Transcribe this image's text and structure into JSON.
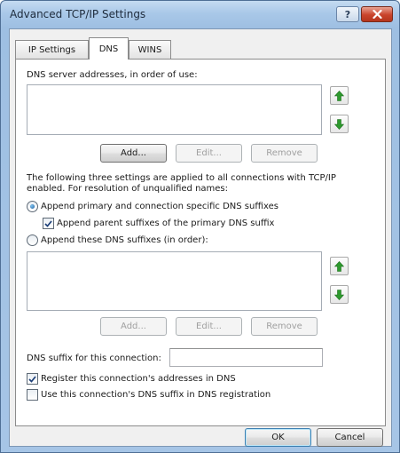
{
  "window": {
    "title": "Advanced TCP/IP Settings",
    "help_glyph": "?"
  },
  "tabs": [
    {
      "label": "IP Settings",
      "selected": false
    },
    {
      "label": "DNS",
      "selected": true
    },
    {
      "label": "WINS",
      "selected": false
    }
  ],
  "dns_servers": {
    "label": "DNS server addresses, in order of use:",
    "items": [],
    "buttons": {
      "add": "Add...",
      "edit": "Edit...",
      "remove": "Remove"
    }
  },
  "resolution": {
    "description_line1": "The following three settings are applied to all connections with TCP/IP",
    "description_line2": "enabled. For resolution of unqualified names:",
    "append_primary_label": "Append primary and connection specific DNS suffixes",
    "append_primary_selected": true,
    "append_parent_label": "Append parent suffixes of the primary DNS suffix",
    "append_parent_checked": true,
    "append_these_label": "Append these DNS suffixes (in order):",
    "append_these_selected": false
  },
  "dns_suffixes": {
    "items": [],
    "buttons": {
      "add": "Add...",
      "edit": "Edit...",
      "remove": "Remove"
    }
  },
  "connection_suffix": {
    "label": "DNS suffix for this connection:",
    "value": ""
  },
  "register_addresses": {
    "label": "Register this connection's addresses in DNS",
    "checked": true
  },
  "use_suffix_registration": {
    "label": "Use this connection's DNS suffix in DNS registration",
    "checked": false
  },
  "footer": {
    "ok": "OK",
    "cancel": "Cancel"
  },
  "colors": {
    "arrow_green": "#2e9a2e",
    "check_mark": "#1c3f78",
    "close_red": "#c9432b"
  }
}
